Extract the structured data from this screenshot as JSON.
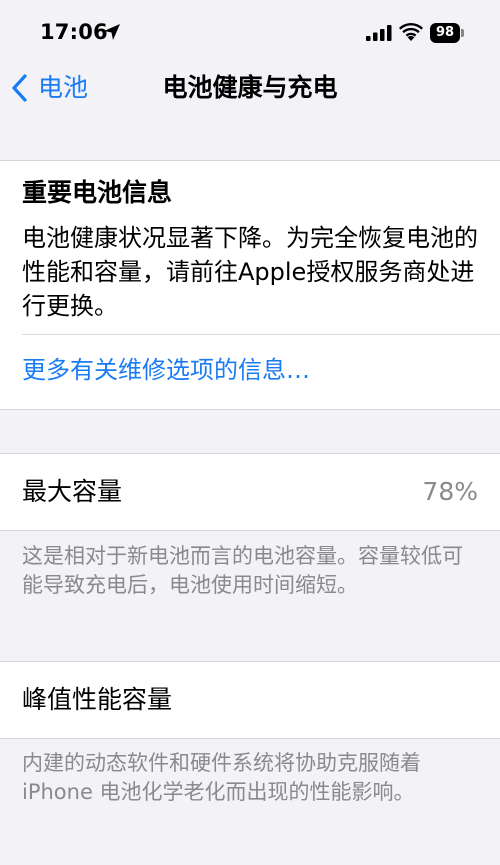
{
  "status_bar": {
    "time": "17:06",
    "location_icon": "location-arrow-icon",
    "signal_icon": "cellular-signal-icon",
    "wifi_icon": "wifi-icon",
    "battery_level": "98"
  },
  "nav": {
    "back_label": "电池",
    "title": "电池健康与充电"
  },
  "important_info": {
    "title": "重要电池信息",
    "body": "电池健康状况显著下降。为完全恢复电池的性能和容量，请前往Apple授权服务商处进行更换。",
    "link": "更多有关维修选项的信息…"
  },
  "max_capacity": {
    "label": "最大容量",
    "value": "78%",
    "footnote": "这是相对于新电池而言的电池容量。容量较低可能导致充电后，电池使用时间缩短。"
  },
  "peak_performance": {
    "label": "峰值性能容量",
    "footnote": "内建的动态软件和硬件系统将协助克服随着 iPhone 电池化学老化而出现的性能影响。"
  },
  "colors": {
    "accent": "#1a7cf5",
    "background": "#f2f2f7",
    "secondary_text": "#8a8a8e"
  }
}
